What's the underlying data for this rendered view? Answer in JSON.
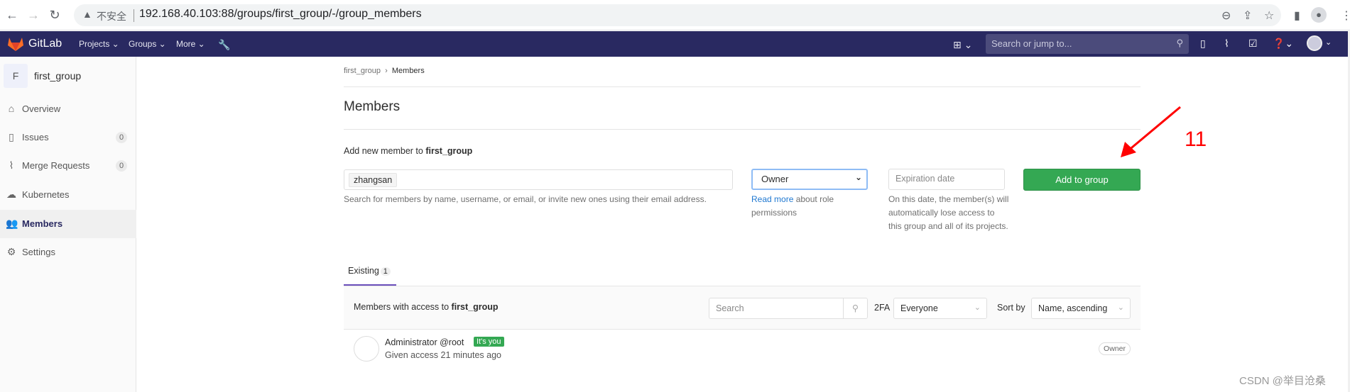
{
  "browser": {
    "insecure_label": "不安全",
    "url": "192.168.40.103:88/groups/first_group/-/group_members"
  },
  "navbar": {
    "brand": "GitLab",
    "items": [
      "Projects ⌄",
      "Groups ⌄",
      "More ⌄"
    ],
    "search_placeholder": "Search or jump to..."
  },
  "sidebar": {
    "group_initial": "F",
    "group_name": "first_group",
    "items": [
      {
        "label": "Overview",
        "icon": "home-icon"
      },
      {
        "label": "Issues",
        "count": "0",
        "icon": "issues-icon"
      },
      {
        "label": "Merge Requests",
        "count": "0",
        "icon": "merge-request-icon"
      },
      {
        "label": "Kubernetes",
        "icon": "kubernetes-icon"
      },
      {
        "label": "Members",
        "icon": "members-icon",
        "active": true
      },
      {
        "label": "Settings",
        "icon": "gear-icon"
      }
    ]
  },
  "breadcrumb": {
    "parent": "first_group",
    "current": "Members"
  },
  "page_title": "Members",
  "add": {
    "label_prefix": "Add new member to ",
    "group": "first_group",
    "token": "zhangsan",
    "help": "Search for members by name, username, or email, or invite new ones using their email address.",
    "role": "Owner",
    "read_more": "Read more",
    "read_more_rest": " about role permissions",
    "expiration_placeholder": "Expiration date",
    "expiration_help": "On this date, the member(s) will automatically lose access to this group and all of its projects.",
    "button": "Add to group"
  },
  "existing": {
    "tab_label": "Existing",
    "count": "1",
    "header_prefix": "Members with access to ",
    "group": "first_group",
    "search_placeholder": "Search",
    "twofa_label": "2FA",
    "twofa_value": "Everyone",
    "sort_label": "Sort by",
    "sort_value": "Name, ascending"
  },
  "members": [
    {
      "name": "Administrator @root",
      "badge": "It's you",
      "given": "Given access 21 minutes ago",
      "role": "Owner"
    }
  ],
  "annotation": {
    "number": "11",
    "color": "#ff0000"
  },
  "watermark": "CSDN @举目沧桑",
  "colors": {
    "navbar": "#292961",
    "primary_button": "#34a853",
    "link": "#1f78d1"
  }
}
